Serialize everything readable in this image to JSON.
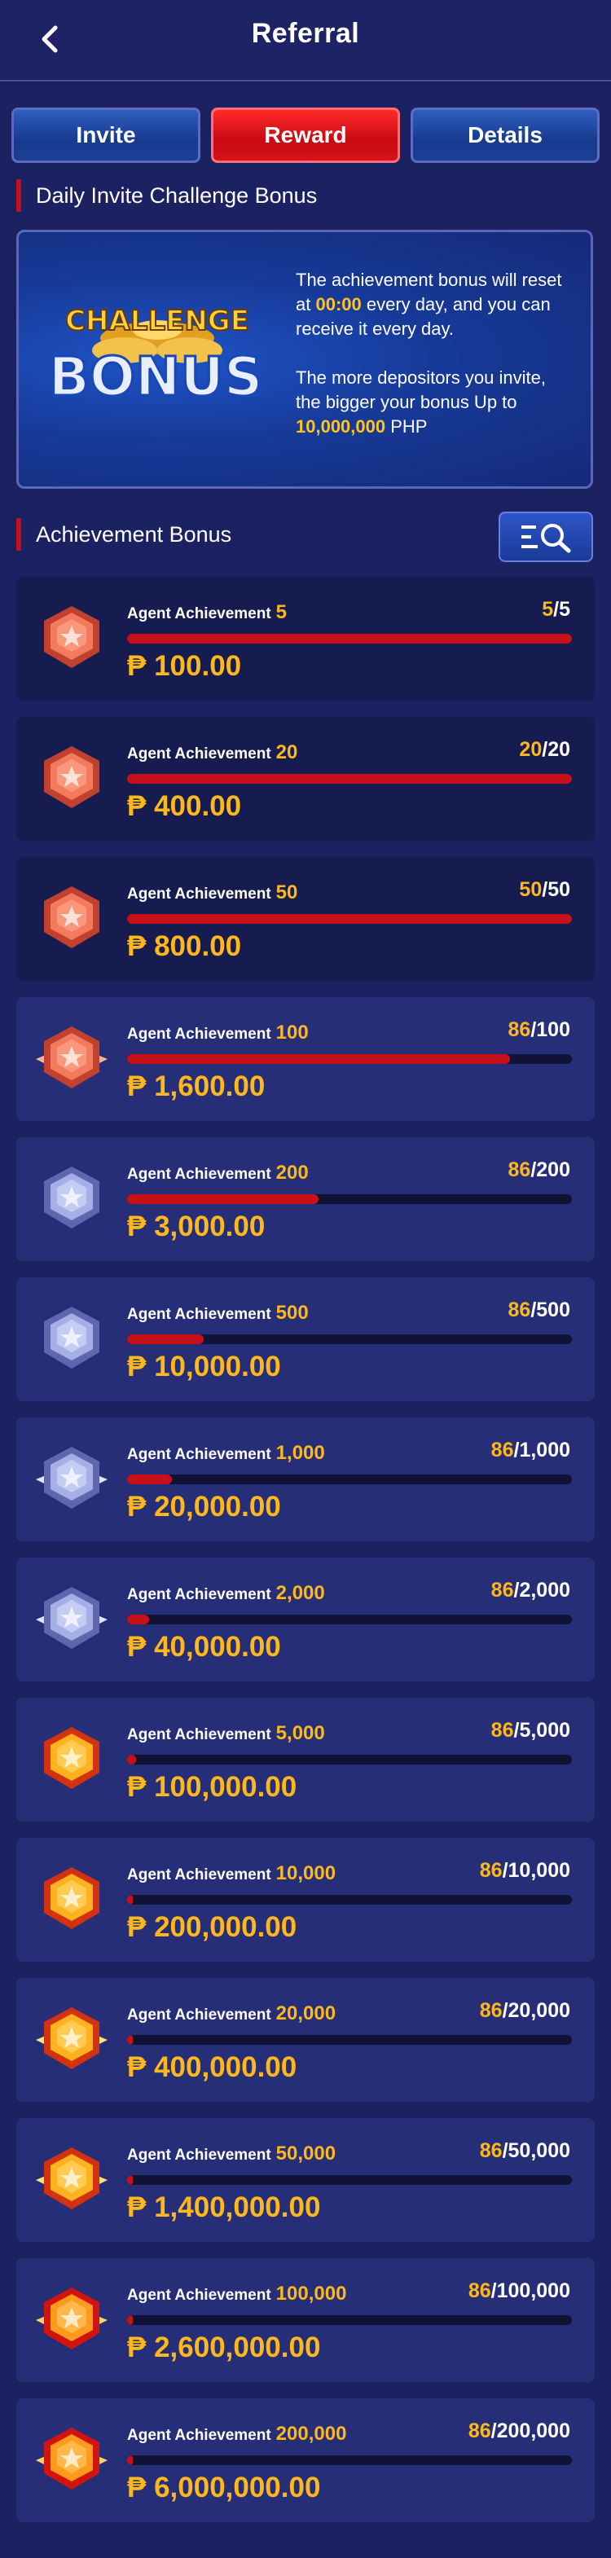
{
  "header": {
    "title": "Referral",
    "back_icon": "chevron-left-icon"
  },
  "tabs": [
    {
      "label": "Invite",
      "active": false
    },
    {
      "label": "Reward",
      "active": true
    },
    {
      "label": "Details",
      "active": false
    }
  ],
  "daily": {
    "heading": "Daily Invite Challenge Bonus",
    "art_word_top": "CHALLENGE",
    "art_word_bottom": "BONUS",
    "line1_a": "The achievement bonus will reset at ",
    "line1_time": "00:00",
    "line1_b": " every day, and you can receive it every day.",
    "line2_a": "The more depositors you invite, the bigger your bonus Up to ",
    "line2_amount": "10,000,000",
    "line2_b": " PHP"
  },
  "achievement": {
    "heading": "Achievement Bonus",
    "filter_icon": "filter-search-icon",
    "label": "Agent Achievement",
    "items": [
      {
        "target": "5",
        "current": "5",
        "total": "5",
        "progress": 1.0,
        "amount": "₱ 100.00",
        "tier": "bronze",
        "done": true
      },
      {
        "target": "20",
        "current": "20",
        "total": "20",
        "progress": 1.0,
        "amount": "₱ 400.00",
        "tier": "bronze",
        "done": true
      },
      {
        "target": "50",
        "current": "50",
        "total": "50",
        "progress": 1.0,
        "amount": "₱ 800.00",
        "tier": "bronze",
        "done": true
      },
      {
        "target": "100",
        "current": "86",
        "total": "100",
        "progress": 0.86,
        "amount": "₱ 1,600.00",
        "tier": "bronze-wing",
        "done": false
      },
      {
        "target": "200",
        "current": "86",
        "total": "200",
        "progress": 0.43,
        "amount": "₱ 3,000.00",
        "tier": "silver",
        "done": false
      },
      {
        "target": "500",
        "current": "86",
        "total": "500",
        "progress": 0.172,
        "amount": "₱ 10,000.00",
        "tier": "silver",
        "done": false
      },
      {
        "target": "1,000",
        "current": "86",
        "total": "1,000",
        "progress": 0.1,
        "amount": "₱ 20,000.00",
        "tier": "silver-wing",
        "done": false
      },
      {
        "target": "2,000",
        "current": "86",
        "total": "2,000",
        "progress": 0.05,
        "amount": "₱ 40,000.00",
        "tier": "silver-wing",
        "done": false
      },
      {
        "target": "5,000",
        "current": "86",
        "total": "5,000",
        "progress": 0.02,
        "amount": "₱ 100,000.00",
        "tier": "gold",
        "done": false
      },
      {
        "target": "10,000",
        "current": "86",
        "total": "10,000",
        "progress": 0.01,
        "amount": "₱ 200,000.00",
        "tier": "gold",
        "done": false
      },
      {
        "target": "20,000",
        "current": "86",
        "total": "20,000",
        "progress": 0.005,
        "amount": "₱ 400,000.00",
        "tier": "gold-wing",
        "done": false
      },
      {
        "target": "50,000",
        "current": "86",
        "total": "50,000",
        "progress": 0.002,
        "amount": "₱ 1,400,000.00",
        "tier": "gold-wing",
        "done": false
      },
      {
        "target": "100,000",
        "current": "86",
        "total": "100,000",
        "progress": 0.001,
        "amount": "₱ 2,600,000.00",
        "tier": "ruby",
        "done": false
      },
      {
        "target": "200,000",
        "current": "86",
        "total": "200,000",
        "progress": 0.0005,
        "amount": "₱ 6,000,000.00",
        "tier": "ruby",
        "done": false
      }
    ]
  },
  "colors": {
    "background": "#1b2161",
    "accent_red": "#c8101a",
    "gold": "#ffb81c",
    "tab_blue": "#1a3f95"
  }
}
